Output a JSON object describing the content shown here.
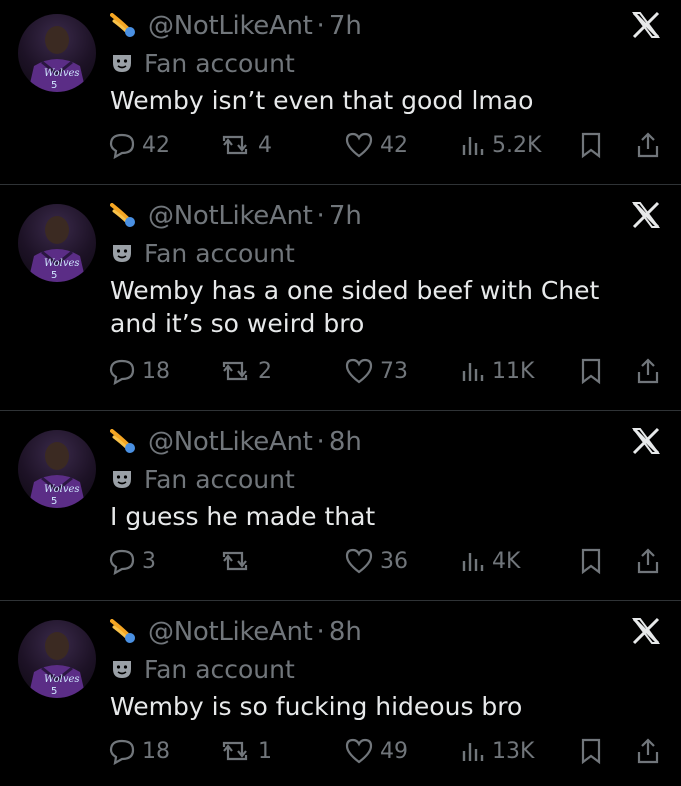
{
  "tweets": [
    {
      "handle": "@NotLikeAnt",
      "dot": "·",
      "time": "7h",
      "badge": "Fan account",
      "text": "Wemby isn’t even that good lmao",
      "replies": "42",
      "reposts": "4",
      "likes": "42",
      "views": "5.2K"
    },
    {
      "handle": "@NotLikeAnt",
      "dot": "·",
      "time": "7h",
      "badge": "Fan account",
      "text": "Wemby has a one sided beef with Chet and it’s so weird bro",
      "replies": "18",
      "reposts": "2",
      "likes": "73",
      "views": "11K"
    },
    {
      "handle": "@NotLikeAnt",
      "dot": "·",
      "time": "8h",
      "badge": "Fan account",
      "text": "I guess he made that",
      "replies": "3",
      "reposts": "",
      "likes": "36",
      "views": "4K"
    },
    {
      "handle": "@NotLikeAnt",
      "dot": "·",
      "time": "8h",
      "badge": "Fan account",
      "text": "Wemby is so fucking hideous bro",
      "replies": "18",
      "reposts": "1",
      "likes": "49",
      "views": "13K"
    }
  ],
  "avatar_jersey_text": "Wolves",
  "avatar_jersey_number": "5",
  "icons": {
    "comet": "comet-emoji-icon",
    "mask": "performing-arts-mask-icon",
    "close": "x-logo-icon",
    "reply": "reply-icon",
    "repost": "repost-icon",
    "like": "heart-icon",
    "views": "views-bar-icon",
    "bookmark": "bookmark-icon",
    "share": "share-icon"
  },
  "colors": {
    "background": "#000000",
    "text": "#e7e9ea",
    "secondary": "#71767b",
    "divider": "#2f3336"
  }
}
